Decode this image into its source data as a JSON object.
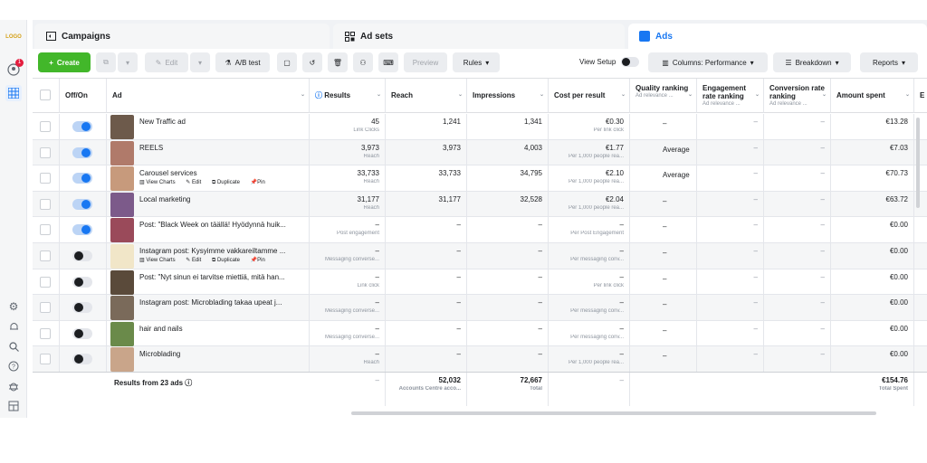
{
  "logo_text": "LOGO",
  "rail": {
    "notification_count": "1",
    "icons": [
      "account-icon",
      "grid-icon",
      "settings-icon",
      "bell-icon",
      "search-icon",
      "help-icon",
      "bug-icon",
      "panel-icon"
    ]
  },
  "tabs": [
    {
      "label": "Campaigns",
      "icon": "folder-icon"
    },
    {
      "label": "Ad sets",
      "icon": "grid-icon"
    },
    {
      "label": "Ads",
      "icon": "ads-icon",
      "active": true
    }
  ],
  "toolbar": {
    "create": "Create",
    "edit": "Edit",
    "ab_test": "A/B test",
    "preview": "Preview",
    "rules": "Rules",
    "view_setup": "View Setup",
    "columns": "Columns: Performance",
    "breakdown": "Breakdown",
    "reports": "Reports"
  },
  "columns": {
    "offon": "Off/On",
    "ad": "Ad",
    "results": "Results",
    "reach": "Reach",
    "impressions": "Impressions",
    "cost_per_result": "Cost per result",
    "quality": "Quality ranking",
    "quality_sub": "Ad relevance ...",
    "engagement": "Engagement rate ranking",
    "engagement_sub": "Ad relevance ...",
    "conversion": "Conversion rate ranking",
    "conversion_sub": "Ad relevance ...",
    "amount": "Amount spent",
    "last": "E"
  },
  "row_actions": {
    "view_charts": "View Charts",
    "edit": "Edit",
    "duplicate": "Duplicate",
    "pin": "Pin"
  },
  "rows": [
    {
      "on": true,
      "name": "New Traffic ad",
      "results": "45",
      "results_sub": "Link Clicks",
      "reach": "1,241",
      "impressions": "1,341",
      "cpr": "€0.30",
      "cpr_sub": "Per link click",
      "quality": "–",
      "engagement": "–",
      "conversion": "–",
      "amount": "€13.28",
      "actions": false,
      "thumb": "#6d5a4b"
    },
    {
      "on": true,
      "name": "REELS",
      "results": "3,973",
      "results_sub": "Reach",
      "reach": "3,973",
      "impressions": "4,003",
      "cpr": "€1.77",
      "cpr_sub": "Per 1,000 people rea...",
      "quality": "Average",
      "engagement": "–",
      "conversion": "–",
      "amount": "€7.03",
      "actions": false,
      "thumb": "#b07a6a"
    },
    {
      "on": true,
      "name": "Carousel services",
      "results": "33,733",
      "results_sub": "Reach",
      "reach": "33,733",
      "impressions": "34,795",
      "cpr": "€2.10",
      "cpr_sub": "Per 1,000 people rea...",
      "quality": "Average",
      "engagement": "–",
      "conversion": "–",
      "amount": "€70.73",
      "actions": true,
      "thumb": "#c79a7c"
    },
    {
      "on": true,
      "name": "Local marketing",
      "results": "31,177",
      "results_sub": "Reach",
      "reach": "31,177",
      "impressions": "32,528",
      "cpr": "€2.04",
      "cpr_sub": "Per 1,000 people rea...",
      "quality": "–",
      "engagement": "–",
      "conversion": "–",
      "amount": "€63.72",
      "actions": false,
      "thumb": "#7c5a8a"
    },
    {
      "on": true,
      "name": "Post: \"Black Week on täällä! Hyödynnä huik...",
      "results": "–",
      "results_sub": "Post engagement",
      "reach": "–",
      "impressions": "–",
      "cpr": "–",
      "cpr_sub": "Per Post Engagement",
      "quality": "–",
      "engagement": "–",
      "conversion": "–",
      "amount": "€0.00",
      "actions": false,
      "thumb": "#9a4a5a"
    },
    {
      "on": false,
      "name": "Instagram post: Kysyimme vakkareiltamme ...",
      "results": "–",
      "results_sub": "Messaging converse...",
      "reach": "–",
      "impressions": "–",
      "cpr": "–",
      "cpr_sub": "Per messaging conv...",
      "quality": "–",
      "engagement": "–",
      "conversion": "–",
      "amount": "€0.00",
      "actions": true,
      "thumb": "#f1e6c8"
    },
    {
      "on": false,
      "name": "Post: \"Nyt sinun ei tarvitse miettiä, mitä han...",
      "results": "–",
      "results_sub": "Link click",
      "reach": "–",
      "impressions": "–",
      "cpr": "–",
      "cpr_sub": "Per link click",
      "quality": "–",
      "engagement": "–",
      "conversion": "–",
      "amount": "€0.00",
      "actions": false,
      "thumb": "#5a4a3a"
    },
    {
      "on": false,
      "name": "Instagram post: Microblading takaa upeat j...",
      "results": "–",
      "results_sub": "Messaging converse...",
      "reach": "–",
      "impressions": "–",
      "cpr": "–",
      "cpr_sub": "Per messaging conv...",
      "quality": "–",
      "engagement": "–",
      "conversion": "–",
      "amount": "€0.00",
      "actions": false,
      "thumb": "#7a6a5a"
    },
    {
      "on": false,
      "name": "hair and nails",
      "results": "–",
      "results_sub": "Messaging converse...",
      "reach": "–",
      "impressions": "–",
      "cpr": "–",
      "cpr_sub": "Per messaging conv...",
      "quality": "–",
      "engagement": "–",
      "conversion": "–",
      "amount": "€0.00",
      "actions": false,
      "thumb": "#6a8a4a"
    },
    {
      "on": false,
      "name": "Microblading",
      "results": "–",
      "results_sub": "Reach",
      "reach": "–",
      "impressions": "–",
      "cpr": "–",
      "cpr_sub": "Per 1,000 people rea...",
      "quality": "–",
      "engagement": "–",
      "conversion": "–",
      "amount": "€0.00",
      "actions": false,
      "thumb": "#c9a58a"
    }
  ],
  "footer": {
    "label": "Results from 23 ads",
    "results": "–",
    "reach": "52,032",
    "reach_sub": "Accounts Centre acco...",
    "impressions": "72,667",
    "impressions_sub": "Total",
    "cpr": "–",
    "amount": "€154.76",
    "amount_sub": "Total Spent"
  }
}
